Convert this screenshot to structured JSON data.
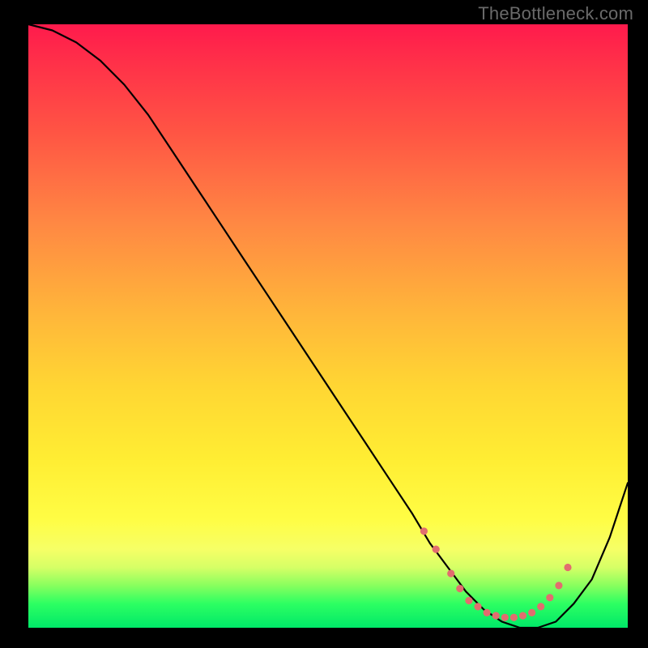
{
  "watermark": "TheBottleneck.com",
  "chart_data": {
    "type": "line",
    "title": "",
    "xlabel": "",
    "ylabel": "",
    "xlim": [
      0,
      100
    ],
    "ylim": [
      0,
      100
    ],
    "series": [
      {
        "name": "curve",
        "x": [
          0,
          4,
          8,
          12,
          16,
          20,
          24,
          28,
          32,
          36,
          40,
          44,
          48,
          52,
          56,
          60,
          64,
          67,
          70,
          73,
          76,
          79,
          82,
          85,
          88,
          91,
          94,
          97,
          100
        ],
        "values": [
          100,
          99,
          97,
          94,
          90,
          85,
          79,
          73,
          67,
          61,
          55,
          49,
          43,
          37,
          31,
          25,
          19,
          14,
          10,
          6,
          3,
          1,
          0,
          0,
          1,
          4,
          8,
          15,
          24
        ]
      }
    ],
    "markers": {
      "name": "dotted-valley",
      "color": "#e26d6f",
      "x": [
        66,
        68,
        70.5,
        72,
        73.5,
        75,
        76.5,
        78,
        79.5,
        81,
        82.5,
        84,
        85.5,
        87,
        88.5,
        90
      ],
      "values": [
        16,
        13,
        9,
        6.5,
        4.5,
        3.5,
        2.5,
        2,
        1.7,
        1.7,
        2,
        2.5,
        3.5,
        5,
        7,
        10
      ]
    }
  }
}
